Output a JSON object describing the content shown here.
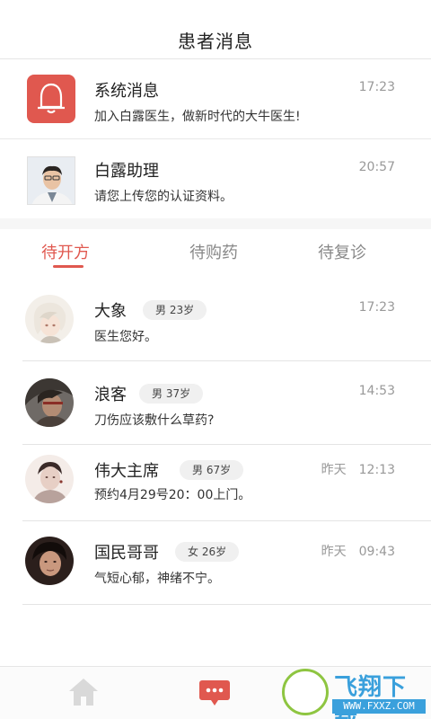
{
  "header": {
    "title": "患者消息"
  },
  "system_messages": [
    {
      "name": "系统消息",
      "message": "加入白露医生，做新时代的大牛医生!",
      "time": "17:23",
      "icon": "bell-icon"
    },
    {
      "name": "白露助理",
      "message": "请您上传您的认证资料。",
      "time": "20:57",
      "icon": "assistant-avatar"
    }
  ],
  "tabs": [
    {
      "label": "待开方",
      "active": true
    },
    {
      "label": "待购药",
      "active": false
    },
    {
      "label": "待复诊",
      "active": false
    }
  ],
  "patients": [
    {
      "name": "大象",
      "badge": "男 23岁",
      "day": "",
      "time": "17:23",
      "message": "医生您好。"
    },
    {
      "name": "浪客",
      "badge": "男 37岁",
      "day": "",
      "time": "14:53",
      "message": "刀伤应该敷什么草药?"
    },
    {
      "name": "伟大主席",
      "badge": "男 67岁",
      "day": "昨天",
      "time": "12:13",
      "message": "预约4月29号20：00上门。"
    },
    {
      "name": "国民哥哥",
      "badge": "女 26岁",
      "day": "昨天",
      "time": "09:43",
      "message": "气短心郁，神绪不宁。"
    }
  ],
  "bottom_nav": [
    {
      "icon": "home-icon",
      "active": false
    },
    {
      "icon": "chat-bubble-icon",
      "active": true
    }
  ],
  "watermark": {
    "title": "飞翔下载",
    "url": "WWW.FXXZ.COM"
  },
  "colors": {
    "accent": "#e0584f",
    "muted": "#999999",
    "watermark_blue": "#3aa0dc",
    "watermark_green": "#8ec541"
  }
}
